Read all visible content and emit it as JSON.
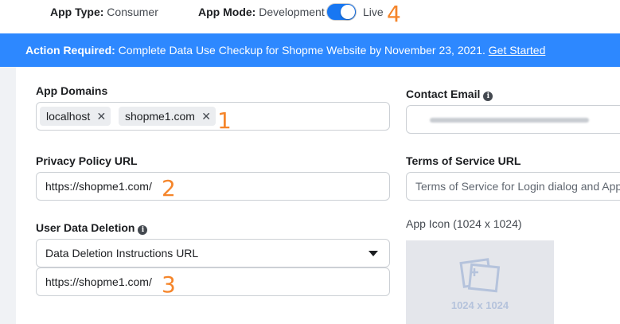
{
  "header": {
    "app_type_label": "App Type:",
    "app_type_value": "Consumer",
    "app_mode_label": "App Mode:",
    "app_mode_value": "Development",
    "live_label": "Live",
    "mode_toggle_on": true
  },
  "banner": {
    "bold": "Action Required:",
    "text": "Complete Data Use Checkup for Shopme Website by November 23, 2021.",
    "link": "Get Started"
  },
  "form": {
    "app_domains_label": "App Domains",
    "app_domains": [
      "localhost",
      "shopme1.com"
    ],
    "contact_email_label": "Contact Email",
    "privacy_label": "Privacy Policy URL",
    "privacy_value": "https://shopme1.com/",
    "terms_label": "Terms of Service URL",
    "terms_placeholder": "Terms of Service for Login dialog and App",
    "deletion_label": "User Data Deletion",
    "deletion_select": "Data Deletion Instructions URL",
    "deletion_value": "https://shopme1.com/",
    "app_icon_label": "App Icon (1024 x 1024)",
    "app_icon_size": "1024 x 1024"
  },
  "annotations": {
    "n1": "1",
    "n2": "2",
    "n3": "3",
    "n4": "4"
  },
  "colors": {
    "banner": "#2d88ff",
    "toggle": "#1877f2",
    "annotation": "#f5852a"
  }
}
